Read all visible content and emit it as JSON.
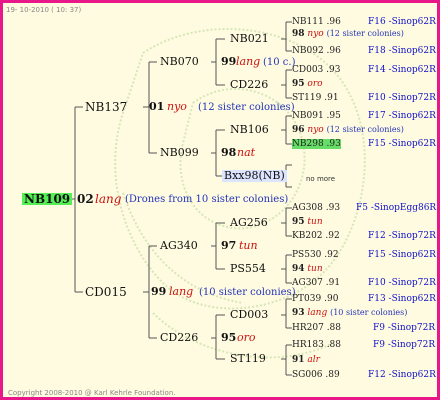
{
  "header": {
    "date": "19- 10-2010 ( 10: 37)"
  },
  "footer": {
    "copyright": "Copyright 2008-2010 @ Karl Kehrle Foundation."
  },
  "root": {
    "id": "NB109",
    "num": "02",
    "race": "lang",
    "note": "(Drones from 10 sister colonies)"
  },
  "gen1": {
    "top": {
      "id": "NB137"
    },
    "bottom": {
      "id": "CD015"
    }
  },
  "gen1_top": {
    "num": "01",
    "race": "nyo",
    "note": "(12 sister colonies)"
  },
  "gen1_bottom": {
    "num": "99",
    "race": "lang",
    "note": "(10 sister colonies)"
  },
  "gen2": {
    "a": {
      "id": "NB070"
    },
    "b": {
      "id": "NB099"
    },
    "c": {
      "id": "AG340"
    },
    "d": {
      "id": "CD226"
    }
  },
  "gen2_a": {
    "num": "99",
    "race": "lang",
    "note": "(10 c.)"
  },
  "gen2_b": {
    "num": "98",
    "race": "nat"
  },
  "gen2_c": {
    "num": "97",
    "race": "tun"
  },
  "gen2_d": {
    "num": "95",
    "race": "oro"
  },
  "gen3": {
    "a1": {
      "id": "NB021"
    },
    "a2": {
      "id": "CD226"
    },
    "b1": {
      "id": "NB106"
    },
    "b2": {
      "id": "Bxx98(NB)"
    },
    "c1": {
      "id": "AG256"
    },
    "c2": {
      "id": "PS554"
    },
    "d1": {
      "id": "CD003"
    },
    "d2": {
      "id": "ST119"
    }
  },
  "gen4": [
    {
      "id": "NB111",
      "val": ".96",
      "sire": "F16 -Sinop62R"
    },
    {
      "num": "98",
      "race": "nyo",
      "note": "(12 sister colonies)"
    },
    {
      "id": "NB092",
      "val": ".96",
      "sire": "F18 -Sinop62R"
    },
    {
      "id": "CD003",
      "val": ".93",
      "sire": "F14 -Sinop62R"
    },
    {
      "num": "95",
      "race": "oro"
    },
    {
      "id": "ST119",
      "val": ".91",
      "sire": "F10 -Sinop72R"
    },
    {
      "id": "NB091",
      "val": ".95",
      "sire": "F17 -Sinop62R"
    },
    {
      "num": "96",
      "race": "nyo",
      "note": "(12 sister colonies)"
    },
    {
      "id": "NB298",
      "val": ".93",
      "sire": "F15 -Sinop62R"
    },
    {
      "none": "no more"
    },
    {
      "id": "AG308",
      "val": ".93",
      "sire": "F5 -SinopEgg86R"
    },
    {
      "num": "95",
      "race": "tun"
    },
    {
      "id": "KB202",
      "val": ".92",
      "sire": "F12 -Sinop72R"
    },
    {
      "id": "PS530",
      "val": ".92",
      "sire": "F15 -Sinop62R"
    },
    {
      "num": "94",
      "race": "tun"
    },
    {
      "id": "AG307",
      "val": ".91",
      "sire": "F10 -Sinop72R"
    },
    {
      "id": "PT039",
      "val": ".90",
      "sire": "F13 -Sinop62R"
    },
    {
      "num": "93",
      "race": "lang",
      "note": "(10 sister colonies)"
    },
    {
      "id": "HR207",
      "val": ".88",
      "sire": "F9 -Sinop72R"
    },
    {
      "id": "HR183",
      "val": ".88",
      "sire": "F9 -Sinop72R"
    },
    {
      "num": "91",
      "race": "alr"
    },
    {
      "id": "SG006",
      "val": ".89",
      "sire": "F12 -Sinop62R"
    }
  ]
}
